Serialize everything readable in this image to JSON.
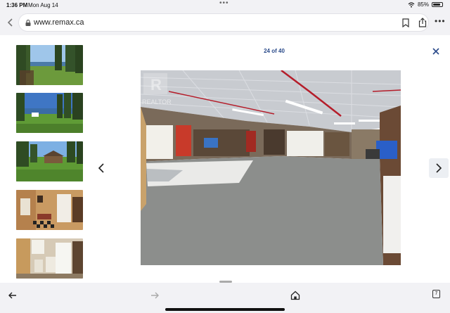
{
  "status_bar": {
    "time": "1:36 PM",
    "date": "Mon Aug 14",
    "battery_percent": "85%",
    "battery_level": 0.85
  },
  "browser": {
    "url": "www.remax.ca",
    "tabs_count": "7"
  },
  "gallery": {
    "counter": "24 of 40",
    "current": 24,
    "total": 40,
    "watermark": "REALTOR",
    "thumbnails": [
      {
        "subject": "lakeside yard with trees"
      },
      {
        "subject": "lawn and trees by lake"
      },
      {
        "subject": "house on lawn with trees"
      },
      {
        "subject": "interior with checkered floor"
      },
      {
        "subject": "kitchen with white cabinets"
      }
    ]
  },
  "icons": {
    "back": "chevron-left-icon",
    "lock": "lock-icon",
    "bookmark": "bookmark-icon",
    "share": "share-icon",
    "more": "ellipsis-icon",
    "close": "close-icon",
    "prev": "chevron-left-icon",
    "next": "chevron-right-icon",
    "tb_back": "arrow-left-icon",
    "tb_forward": "arrow-right-icon",
    "tb_home": "home-icon",
    "tb_tabs": "tabs-icon"
  },
  "colors": {
    "accent": "#2a4a8a",
    "background": "#ffffff",
    "chrome": "#f2f2f5"
  }
}
